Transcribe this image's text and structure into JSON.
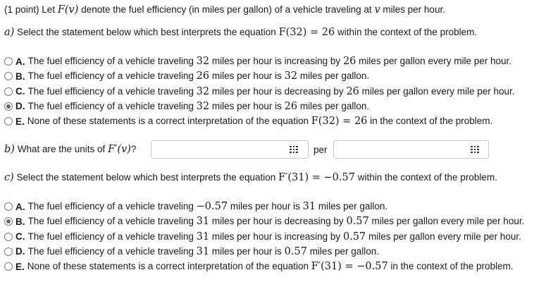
{
  "header": {
    "points": "(1 point)",
    "text": "Let",
    "fv": "F(v)",
    "rest": "denote the fuel efficiency (in miles per gallon) of a vehicle traveling at",
    "v": "v",
    "tail": "miles per hour."
  },
  "partA": {
    "letter": "a)",
    "prompt_pre": "Select the statement below which best interprets the equation",
    "equation": "F(32) = 26",
    "prompt_post": "within the context of the problem.",
    "options": [
      {
        "label": "A.",
        "parts": [
          "The fuel efficiency of a vehicle traveling ",
          "32",
          " miles per hour is increasing by ",
          "26",
          " miles per gallon every mile per hour."
        ],
        "selected": false
      },
      {
        "label": "B.",
        "parts": [
          "The fuel efficiency of a vehicle traveling ",
          "26",
          " miles per hour is ",
          "32",
          " miles per gallon."
        ],
        "selected": false
      },
      {
        "label": "C.",
        "parts": [
          "The fuel efficiency of a vehicle traveling ",
          "32",
          " miles per hour is decreasing by ",
          "26",
          " miles per gallon every mile per hour."
        ],
        "selected": false
      },
      {
        "label": "D.",
        "parts": [
          "The fuel efficiency of a vehicle traveling ",
          "32",
          " miles per hour is ",
          "26",
          " miles per gallon."
        ],
        "selected": true
      },
      {
        "label": "E.",
        "parts": [
          "None of these statements is a correct interpretation of the equation ",
          "F(32) = 26",
          " in the context of the problem."
        ],
        "selected": false
      }
    ]
  },
  "partB": {
    "letter": "b)",
    "prompt_pre": "What are the units of",
    "expr": "F′(v)",
    "prompt_post": "?",
    "per": "per",
    "input1_value": "",
    "input2_value": ""
  },
  "partC": {
    "letter": "c)",
    "prompt_pre": "Select the statement below which best interprets the equation",
    "equation": "F′(31) = −0.57",
    "prompt_post": "within the context of the problem.",
    "options": [
      {
        "label": "A.",
        "parts": [
          "The fuel efficiency of a vehicle traveling ",
          "−0.57",
          " miles per hour is ",
          "31",
          " miles per gallon."
        ],
        "selected": false
      },
      {
        "label": "B.",
        "parts": [
          "The fuel efficiency of a vehicle traveling ",
          "31",
          " miles per hour is decreasing by ",
          "0.57",
          " miles per gallon every mile per hour."
        ],
        "selected": true
      },
      {
        "label": "C.",
        "parts": [
          "The fuel efficiency of a vehicle traveling ",
          "31",
          " miles per hour is increasing by ",
          "0.57",
          " miles per gallon every mile per hour."
        ],
        "selected": false
      },
      {
        "label": "D.",
        "parts": [
          "The fuel efficiency of a vehicle traveling ",
          "31",
          " miles per hour is ",
          "0.57",
          " miles per gallon."
        ],
        "selected": false
      },
      {
        "label": "E.",
        "parts": [
          "None of these statements is a correct interpretation of the equation ",
          "F′(31) = −0.57",
          " in the context of the problem."
        ],
        "selected": false
      }
    ]
  },
  "icons": {
    "palette_icon": "grid-3x3"
  }
}
